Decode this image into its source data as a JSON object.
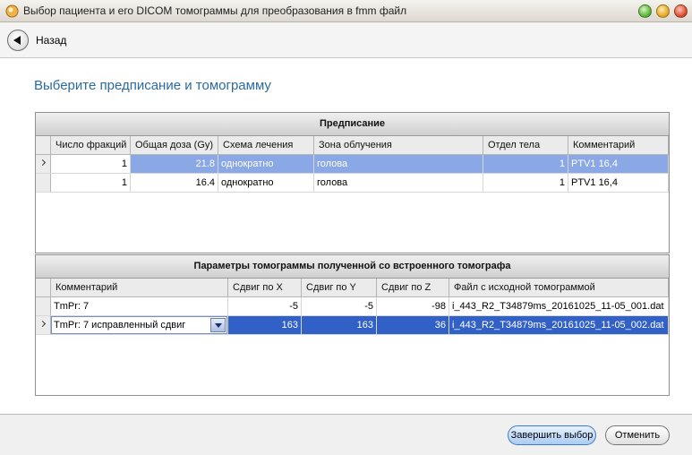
{
  "window": {
    "title": "Выбор пациента и его DICOM томограммы  для преобразования в fmm файл"
  },
  "nav": {
    "back_label": "Назад"
  },
  "heading": "Выберите предписание и томограмму",
  "prescription": {
    "caption": "Предписание",
    "columns": [
      "Число фракций",
      "Общая доза (Gy)",
      "Схема лечения",
      "Зона облучения",
      "Отдел тела",
      "Комментарий"
    ],
    "rows": [
      {
        "fractions": "1",
        "dose": "21.8",
        "scheme": "однократно",
        "zone": "голова",
        "section": "1",
        "comment": "PTV1 16,4",
        "selected": true
      },
      {
        "fractions": "1",
        "dose": "16.4",
        "scheme": "однократно",
        "zone": "голова",
        "section": "1",
        "comment": "PTV1 16,4",
        "selected": false
      }
    ]
  },
  "tomogram": {
    "caption": "Параметры томограммы полученной со встроенного томографа",
    "columns": [
      "Комментарий",
      "Сдвиг по X",
      "Сдвиг по Y",
      "Сдвиг по Z",
      "Файл с исходной томограммой"
    ],
    "rows": [
      {
        "comment": "TmPr: 7",
        "dx": "-5",
        "dy": "-5",
        "dz": "-98",
        "file": "i_443_R2_T34879ms_20161025_11-05_001.dat",
        "selected": false
      },
      {
        "comment": "TmPr: 7 исправленный сдвиг",
        "dx": "163",
        "dy": "163",
        "dz": "36",
        "file": "i_443_R2_T34879ms_20161025_11-05_002.dat",
        "selected": true
      }
    ]
  },
  "footer": {
    "finish_label": "Завершить выбор",
    "cancel_label": "Отменить"
  },
  "colors": {
    "accent": "#2b6a9e",
    "selection": "#3160c6",
    "selection_light": "#8aa7e6"
  }
}
